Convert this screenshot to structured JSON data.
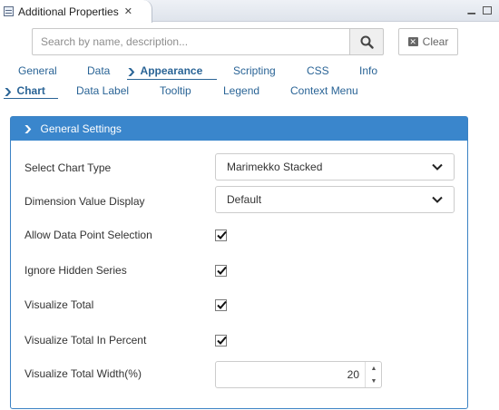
{
  "view": {
    "title": "Additional Properties"
  },
  "search": {
    "placeholder": "Search by name, description...",
    "value": "",
    "clear_label": "Clear"
  },
  "main_tabs": [
    {
      "label": "General",
      "active": false
    },
    {
      "label": "Data",
      "active": false
    },
    {
      "label": "Appearance",
      "active": true
    },
    {
      "label": "Scripting",
      "active": false
    },
    {
      "label": "CSS",
      "active": false
    },
    {
      "label": "Info",
      "active": false
    }
  ],
  "sub_tabs": [
    {
      "label": "Chart",
      "active": true
    },
    {
      "label": "Data Label",
      "active": false
    },
    {
      "label": "Tooltip",
      "active": false
    },
    {
      "label": "Legend",
      "active": false
    },
    {
      "label": "Context Menu",
      "active": false
    }
  ],
  "panel": {
    "title": "General Settings",
    "expanded": true,
    "select_chart_type": {
      "label": "Select Chart Type",
      "value": "Marimekko Stacked"
    },
    "dimension_value_display": {
      "label": "Dimension Value Display",
      "value": "Default"
    },
    "allow_data_point_selection": {
      "label": "Allow Data Point Selection",
      "checked": true
    },
    "ignore_hidden_series": {
      "label": "Ignore Hidden Series",
      "checked": true
    },
    "visualize_total": {
      "label": "Visualize Total",
      "checked": true
    },
    "visualize_total_in_percent": {
      "label": "Visualize Total In Percent",
      "checked": true
    },
    "visualize_total_width": {
      "label": "Visualize Total Width(%)",
      "value": "20"
    }
  },
  "colors": {
    "accent": "#3a86cc",
    "link": "#2a6496"
  }
}
